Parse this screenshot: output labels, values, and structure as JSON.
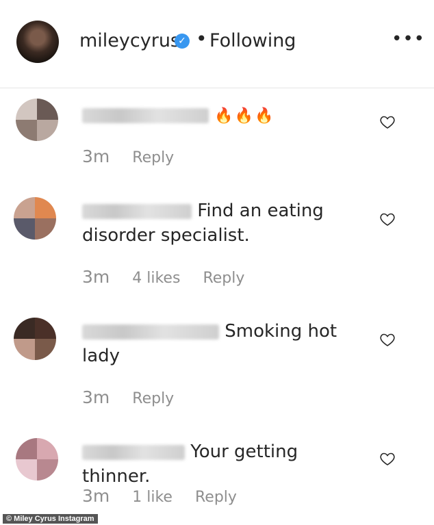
{
  "header": {
    "username": "mileycyrus",
    "verified_icon": "verified-badge-icon",
    "separator": "•",
    "follow_status": "Following",
    "more_label": "•••"
  },
  "comments": [
    {
      "text": "",
      "flames": "🔥🔥🔥",
      "time": "3m",
      "likes": "",
      "reply": "Reply"
    },
    {
      "text": "Find an eating disorder specialist.",
      "time": "3m",
      "likes": "4 likes",
      "reply": "Reply"
    },
    {
      "text": "Smoking hot lady",
      "time": "3m",
      "likes": "",
      "reply": "Reply"
    },
    {
      "text": "Your getting thinner.",
      "time": "3m",
      "likes": "1 like",
      "reply": "Reply"
    }
  ],
  "caption": "© Miley Cyrus Instagram",
  "colors": {
    "verified": "#3897f0",
    "meta": "#8e8e8e",
    "text": "#262626"
  }
}
